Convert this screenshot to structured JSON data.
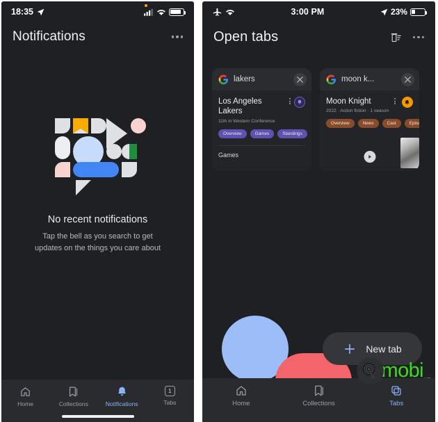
{
  "left_panel": {
    "status_bar": {
      "time": "18:35",
      "location_icon": "location-arrow-icon",
      "signal_icon": "cellular-signal-icon",
      "wifi_icon": "wifi-icon",
      "battery_icon": "battery-icon",
      "recording_dot": "orange-recording-dot"
    },
    "header": {
      "title": "Notifications",
      "overflow_icon": "more-options-icon"
    },
    "empty_state": {
      "illustration": "google-shapes-speech-bubble-illustration",
      "title": "No recent notifications",
      "subtitle": "Tap the bell as you search to get updates on the things you care about"
    },
    "bottom_nav": {
      "items": [
        {
          "label": "Home",
          "icon": "home-icon",
          "active": false
        },
        {
          "label": "Collections",
          "icon": "bookmark-icon",
          "active": false
        },
        {
          "label": "Notifications",
          "icon": "bell-icon",
          "active": true
        },
        {
          "label": "Tabs",
          "icon": "tabs-count-icon",
          "badge": "1",
          "active": false
        }
      ]
    }
  },
  "right_panel": {
    "status_bar": {
      "airplane_icon": "airplane-mode-icon",
      "wifi_icon": "wifi-icon",
      "time": "3:00 PM",
      "location_icon": "location-arrow-icon",
      "battery_percent": "23%",
      "battery_icon": "battery-icon"
    },
    "header": {
      "title": "Open tabs",
      "clear_tabs_icon": "trash-list-icon",
      "overflow_icon": "more-options-icon"
    },
    "tab_cards": [
      {
        "favicon": "google-g-icon",
        "query": "lakers",
        "close_icon": "close-icon",
        "result_title": "Los Angeles Lakers",
        "result_subtitle": "11th in Western Conference",
        "badge_icon": "bell-icon",
        "menu_icon": "vertical-dots-icon",
        "accent": "#6b5fc4",
        "chips": [
          "Overview",
          "Games",
          "Standings"
        ],
        "section_label": "Games"
      },
      {
        "favicon": "google-g-icon",
        "query": "moon k...",
        "close_icon": "close-icon",
        "result_title": "Moon Knight",
        "result_subtitle": "2022 · Action fiction · 1 season",
        "badge_icon": "notify-bell-icon",
        "menu_icon": "vertical-dots-icon",
        "accent": "#8a4b28",
        "chips": [
          "Overview",
          "News",
          "Cast",
          "Episod"
        ],
        "play_icon": "play-icon",
        "thumbnail": "video-thumbnail"
      }
    ],
    "new_tab_button": {
      "label": "New tab",
      "plus_icon": "plus-icon"
    },
    "decoration": {
      "blue_circle": "blue-circle-shape",
      "red_shape": "red-arch-shape"
    },
    "watermark": {
      "mark_icon": "mobi-swirl-icon",
      "text": "mobi",
      "suffix": ".vn",
      "color": "#3cdb1e"
    },
    "bottom_nav": {
      "items": [
        {
          "label": "Home",
          "icon": "home-icon",
          "active": false
        },
        {
          "label": "Collections",
          "icon": "bookmark-icon",
          "active": false
        },
        {
          "label": "Tabs",
          "icon": "tabs-stack-icon",
          "active": true
        }
      ]
    }
  },
  "colors": {
    "background": "#1f2023",
    "nav_background": "#2a2b2e",
    "accent_blue": "#8ab4f8",
    "card": "#2b2c2f"
  }
}
